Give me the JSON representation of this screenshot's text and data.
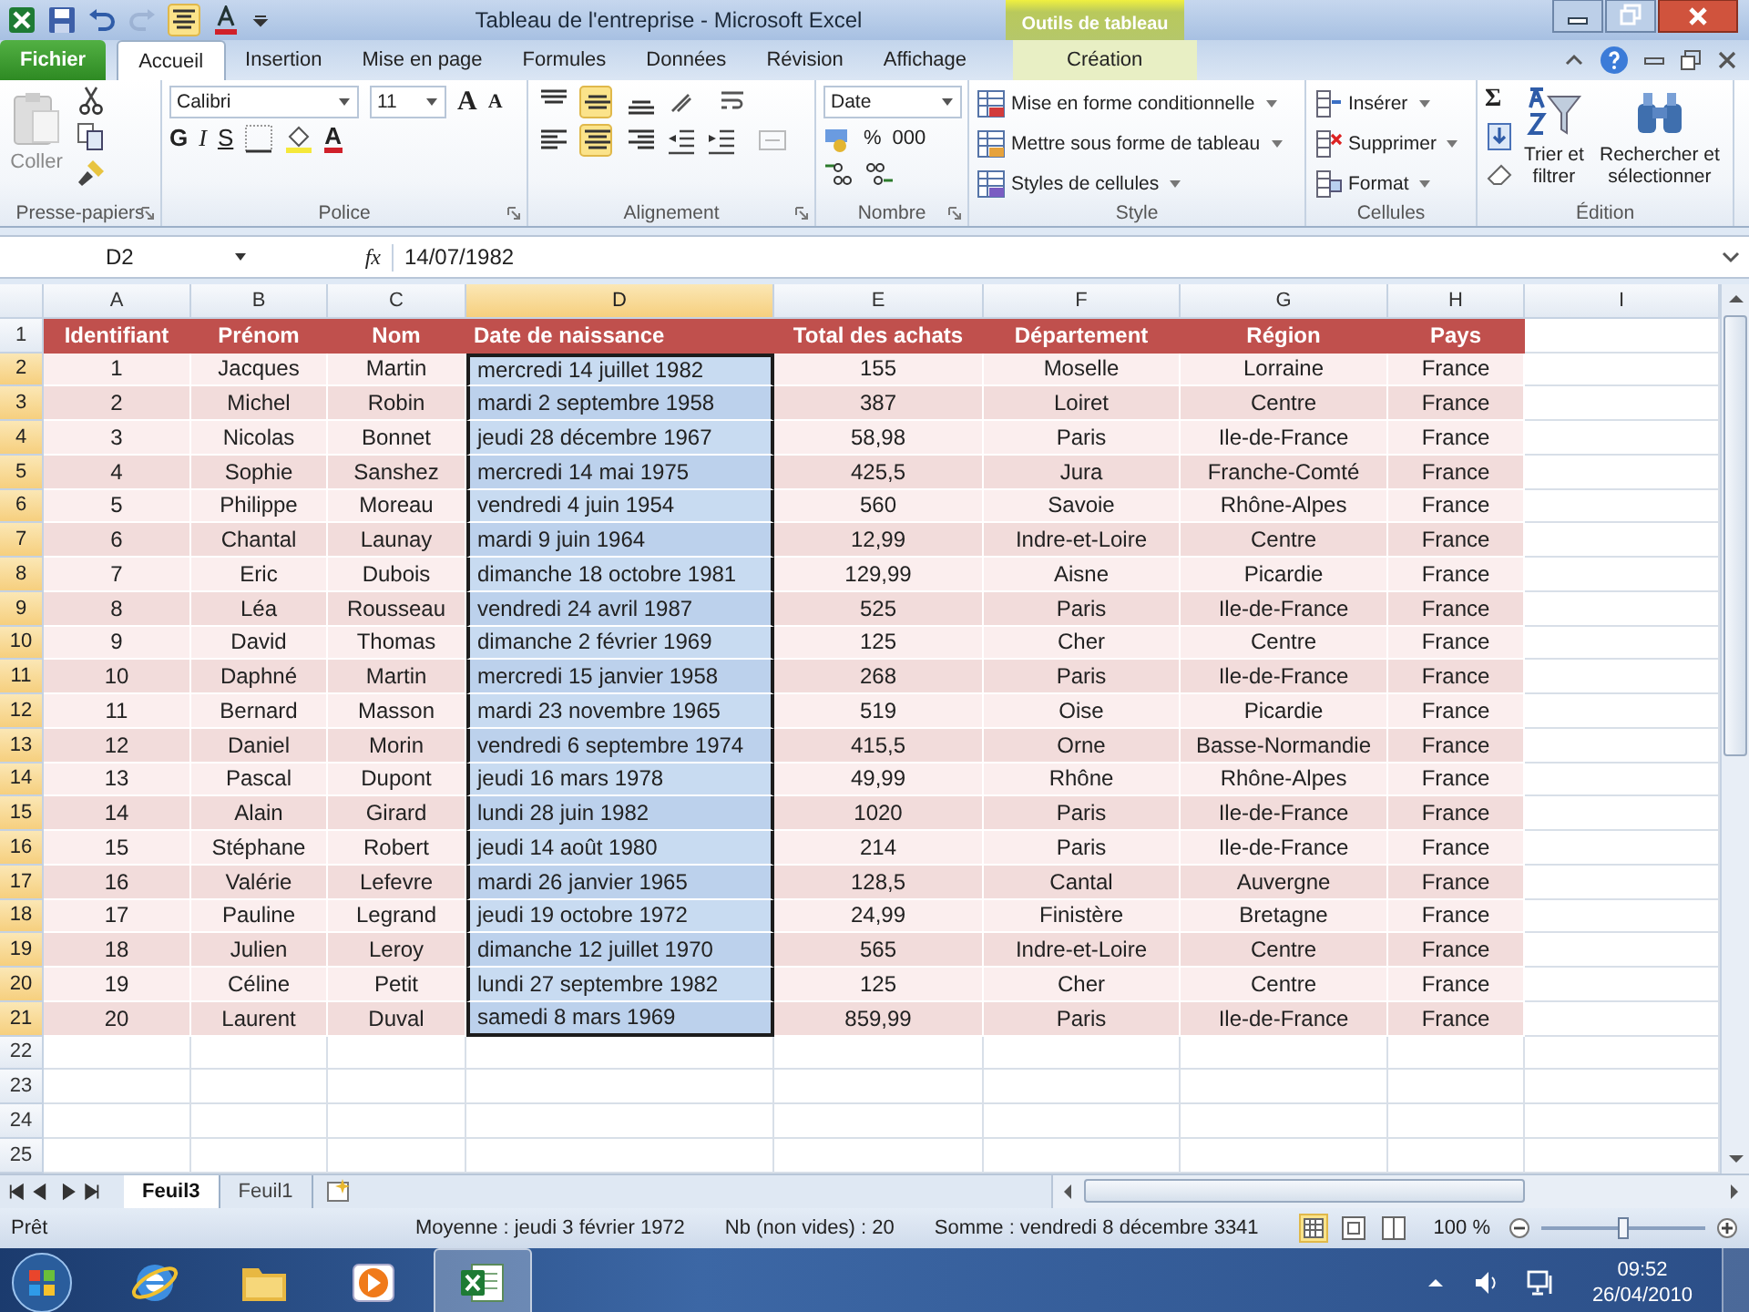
{
  "window": {
    "title": "Tableau de l'entreprise - Microsoft Excel",
    "context_tab": "Outils de tableau"
  },
  "tabs": [
    {
      "label": "Fichier",
      "kind": "file",
      "selected": false
    },
    {
      "label": "Accueil",
      "kind": "tab",
      "selected": true
    },
    {
      "label": "Insertion",
      "kind": "tab",
      "selected": false
    },
    {
      "label": "Mise en page",
      "kind": "tab",
      "selected": false
    },
    {
      "label": "Formules",
      "kind": "tab",
      "selected": false
    },
    {
      "label": "Données",
      "kind": "tab",
      "selected": false
    },
    {
      "label": "Révision",
      "kind": "tab",
      "selected": false
    },
    {
      "label": "Affichage",
      "kind": "tab",
      "selected": false
    },
    {
      "label": "Création",
      "kind": "context",
      "selected": false
    }
  ],
  "ribbon": {
    "clipboard": {
      "paste": "Coller",
      "label": "Presse-papiers"
    },
    "font": {
      "name": "Calibri",
      "size": "11",
      "grow": "A",
      "shrink": "A",
      "bold": "G",
      "italic": "I",
      "underline": "S",
      "color_letter": "A",
      "label": "Police"
    },
    "alignment": {
      "label": "Alignement",
      "buttons": [
        {
          "kind": "top",
          "selected": false
        },
        {
          "kind": "middle",
          "selected": true
        },
        {
          "kind": "bottom",
          "selected": false
        },
        {
          "kind": "left",
          "selected": false
        },
        {
          "kind": "center",
          "selected": true
        },
        {
          "kind": "right",
          "selected": false
        }
      ]
    },
    "number": {
      "format": "Date",
      "percent": "%",
      "thousands": "000",
      "label": "Nombre"
    },
    "style": {
      "label": "Style",
      "buttons": [
        "Mise en forme conditionnelle",
        "Mettre sous forme de tableau",
        "Styles de cellules"
      ]
    },
    "cells": {
      "label": "Cellules",
      "buttons": [
        "Insérer",
        "Supprimer",
        "Format"
      ]
    },
    "editing": {
      "label": "Édition",
      "sum": "Σ",
      "sort": "Trier et filtrer",
      "find": "Rechercher et sélectionner"
    }
  },
  "formula_bar": {
    "name_box": "D2",
    "fx": "fx",
    "value": "14/07/1982"
  },
  "sheet": {
    "columns": [
      {
        "label": "A",
        "selected": false
      },
      {
        "label": "B",
        "selected": false
      },
      {
        "label": "C",
        "selected": false
      },
      {
        "label": "D",
        "selected": true
      },
      {
        "label": "E",
        "selected": false
      },
      {
        "label": "F",
        "selected": false
      },
      {
        "label": "G",
        "selected": false
      },
      {
        "label": "H",
        "selected": false
      },
      {
        "label": "I",
        "selected": false
      }
    ],
    "rows": [
      {
        "number": "1",
        "kind": "header",
        "selected": false,
        "cells": [
          "Identifiant",
          "Prénom",
          "Nom",
          "Date de naissance",
          "Total des achats",
          "Département",
          "Région",
          "Pays"
        ]
      },
      {
        "number": "2",
        "kind": "data",
        "selected": true,
        "cells": [
          "1",
          "Jacques",
          "Martin",
          "mercredi 14 juillet 1982",
          "155",
          "Moselle",
          "Lorraine",
          "France"
        ]
      },
      {
        "number": "3",
        "kind": "data",
        "selected": true,
        "cells": [
          "2",
          "Michel",
          "Robin",
          "mardi 2 septembre 1958",
          "387",
          "Loiret",
          "Centre",
          "France"
        ]
      },
      {
        "number": "4",
        "kind": "data",
        "selected": true,
        "cells": [
          "3",
          "Nicolas",
          "Bonnet",
          "jeudi 28 décembre 1967",
          "58,98",
          "Paris",
          "Ile-de-France",
          "France"
        ]
      },
      {
        "number": "5",
        "kind": "data",
        "selected": true,
        "cells": [
          "4",
          "Sophie",
          "Sanshez",
          "mercredi 14 mai 1975",
          "425,5",
          "Jura",
          "Franche-Comté",
          "France"
        ]
      },
      {
        "number": "6",
        "kind": "data",
        "selected": true,
        "cells": [
          "5",
          "Philippe",
          "Moreau",
          "vendredi 4 juin 1954",
          "560",
          "Savoie",
          "Rhône-Alpes",
          "France"
        ]
      },
      {
        "number": "7",
        "kind": "data",
        "selected": true,
        "cells": [
          "6",
          "Chantal",
          "Launay",
          "mardi 9 juin 1964",
          "12,99",
          "Indre-et-Loire",
          "Centre",
          "France"
        ]
      },
      {
        "number": "8",
        "kind": "data",
        "selected": true,
        "cells": [
          "7",
          "Eric",
          "Dubois",
          "dimanche 18 octobre 1981",
          "129,99",
          "Aisne",
          "Picardie",
          "France"
        ]
      },
      {
        "number": "9",
        "kind": "data",
        "selected": true,
        "cells": [
          "8",
          "Léa",
          "Rousseau",
          "vendredi 24 avril 1987",
          "525",
          "Paris",
          "Ile-de-France",
          "France"
        ]
      },
      {
        "number": "10",
        "kind": "data",
        "selected": true,
        "cells": [
          "9",
          "David",
          "Thomas",
          "dimanche 2 février 1969",
          "125",
          "Cher",
          "Centre",
          "France"
        ]
      },
      {
        "number": "11",
        "kind": "data",
        "selected": true,
        "cells": [
          "10",
          "Daphné",
          "Martin",
          "mercredi 15 janvier 1958",
          "268",
          "Paris",
          "Ile-de-France",
          "France"
        ]
      },
      {
        "number": "12",
        "kind": "data",
        "selected": true,
        "cells": [
          "11",
          "Bernard",
          "Masson",
          "mardi 23 novembre 1965",
          "519",
          "Oise",
          "Picardie",
          "France"
        ]
      },
      {
        "number": "13",
        "kind": "data",
        "selected": true,
        "cells": [
          "12",
          "Daniel",
          "Morin",
          "vendredi 6 septembre 1974",
          "415,5",
          "Orne",
          "Basse-Normandie",
          "France"
        ]
      },
      {
        "number": "14",
        "kind": "data",
        "selected": true,
        "cells": [
          "13",
          "Pascal",
          "Dupont",
          "jeudi 16 mars 1978",
          "49,99",
          "Rhône",
          "Rhône-Alpes",
          "France"
        ]
      },
      {
        "number": "15",
        "kind": "data",
        "selected": true,
        "cells": [
          "14",
          "Alain",
          "Girard",
          "lundi 28 juin 1982",
          "1020",
          "Paris",
          "Ile-de-France",
          "France"
        ]
      },
      {
        "number": "16",
        "kind": "data",
        "selected": true,
        "cells": [
          "15",
          "Stéphane",
          "Robert",
          "jeudi 14 août 1980",
          "214",
          "Paris",
          "Ile-de-France",
          "France"
        ]
      },
      {
        "number": "17",
        "kind": "data",
        "selected": true,
        "cells": [
          "16",
          "Valérie",
          "Lefevre",
          "mardi 26 janvier 1965",
          "128,5",
          "Cantal",
          "Auvergne",
          "France"
        ]
      },
      {
        "number": "18",
        "kind": "data",
        "selected": true,
        "cells": [
          "17",
          "Pauline",
          "Legrand",
          "jeudi 19 octobre 1972",
          "24,99",
          "Finistère",
          "Bretagne",
          "France"
        ]
      },
      {
        "number": "19",
        "kind": "data",
        "selected": true,
        "cells": [
          "18",
          "Julien",
          "Leroy",
          "dimanche 12 juillet 1970",
          "565",
          "Indre-et-Loire",
          "Centre",
          "France"
        ]
      },
      {
        "number": "20",
        "kind": "data",
        "selected": true,
        "cells": [
          "19",
          "Céline",
          "Petit",
          "lundi 27 septembre 1982",
          "125",
          "Cher",
          "Centre",
          "France"
        ]
      },
      {
        "number": "21",
        "kind": "data",
        "selected": true,
        "cells": [
          "20",
          "Laurent",
          "Duval",
          "samedi 8 mars 1969",
          "859,99",
          "Paris",
          "Ile-de-France",
          "France"
        ]
      },
      {
        "number": "22",
        "kind": "empty",
        "selected": false
      },
      {
        "number": "23",
        "kind": "empty",
        "selected": false
      },
      {
        "number": "24",
        "kind": "empty",
        "selected": false
      },
      {
        "number": "25",
        "kind": "empty",
        "selected": false
      }
    ]
  },
  "sheet_tabs": [
    {
      "label": "Feuil3",
      "selected": true
    },
    {
      "label": "Feuil1",
      "selected": false
    }
  ],
  "status_bar": {
    "mode": "Prêt",
    "average": "Moyenne : jeudi 3 février 1972",
    "count": "Nb (non vides) : 20",
    "sum": "Somme : vendredi 8 décembre 3341",
    "zoom": {
      "label": "100 %",
      "level": 0.5
    }
  },
  "taskbar": {
    "apps": [
      {
        "kind": "browser",
        "selected": false
      },
      {
        "kind": "folder",
        "selected": false
      },
      {
        "kind": "media",
        "selected": false
      },
      {
        "kind": "spreadsheet",
        "selected": true
      }
    ],
    "time": "09:52",
    "date": "26/04/2010"
  }
}
